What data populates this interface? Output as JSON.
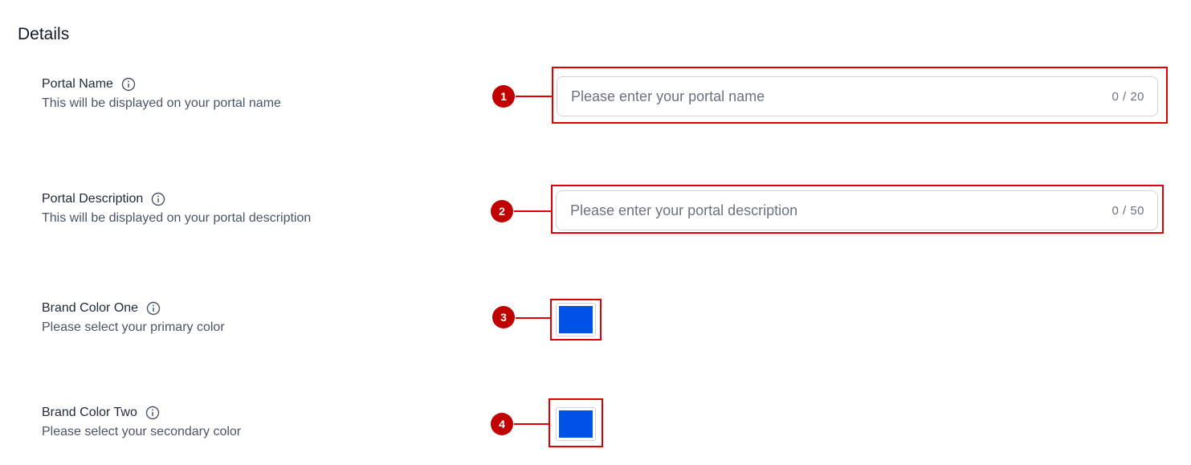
{
  "section": {
    "title": "Details"
  },
  "fields": {
    "portal_name": {
      "label": "Portal Name",
      "description": "This will be displayed on your portal name",
      "placeholder": "Please enter your portal name",
      "value": "",
      "counter": "0 / 20",
      "marker": "1"
    },
    "portal_description": {
      "label": "Portal Description",
      "description": "This will be displayed on your portal description",
      "placeholder": "Please enter your portal description",
      "value": "",
      "counter": "0 / 50",
      "marker": "2"
    },
    "brand_color_one": {
      "label": "Brand Color One",
      "description": "Please select your primary color",
      "color": "#0051E6",
      "marker": "3"
    },
    "brand_color_two": {
      "label": "Brand Color Two",
      "description": "Please select your secondary color",
      "color": "#0051E6",
      "marker": "4"
    }
  },
  "icons": {
    "info": "info-circle-icon"
  },
  "annotation_color": "#e00000"
}
